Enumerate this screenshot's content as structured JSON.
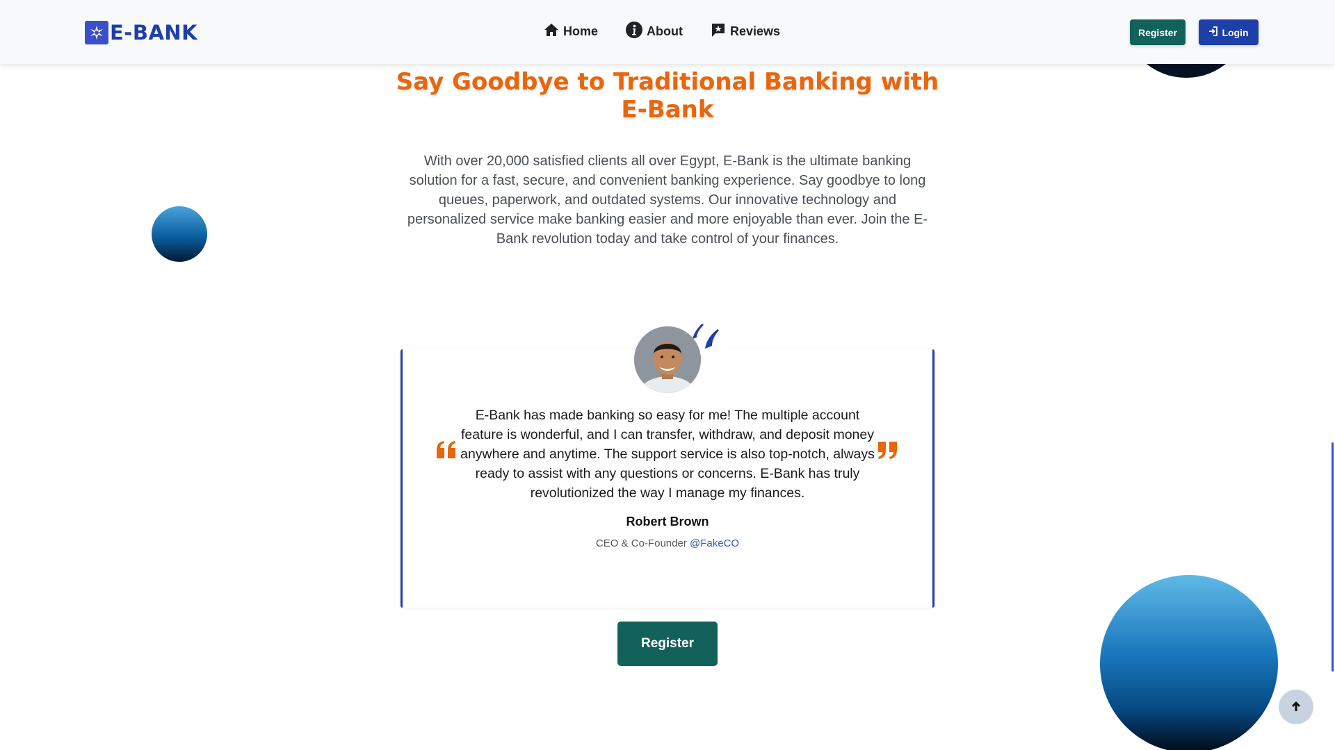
{
  "brand": {
    "name": "E-BANK"
  },
  "nav": {
    "links": [
      {
        "label": "Home",
        "icon": "home-icon"
      },
      {
        "label": "About",
        "icon": "info-icon"
      },
      {
        "label": "Reviews",
        "icon": "reviews-icon"
      }
    ],
    "register_label": "Register",
    "login_label": "Login"
  },
  "hero": {
    "title": "Say Goodbye to Traditional Banking with E-Bank",
    "text": "With over 20,000 satisfied clients all over Egypt, E-Bank is the ultimate banking solution for a fast, secure, and convenient banking experience. Say goodbye to long queues, paperwork, and outdated systems. Our innovative technology and personalized service make banking easier and more enjoyable than ever. Join the E-Bank revolution today and take control of your finances."
  },
  "testimonial": {
    "text": "E-Bank has made banking so easy for me! The multiple account feature is wonderful, and I can transfer, withdraw, and deposit money anywhere and anytime. The support service is also top-notch, always ready to assist with any questions or concerns. E-Bank has truly revolutionized the way I manage my finances.",
    "name": "Robert Brown",
    "role": "CEO & Co-Founder",
    "handle": "@FakeCO"
  },
  "cta": {
    "register_label": "Register"
  },
  "colors": {
    "brand_blue": "#1e3ea8",
    "accent_orange": "#e8660c",
    "register_green": "#12615a"
  }
}
